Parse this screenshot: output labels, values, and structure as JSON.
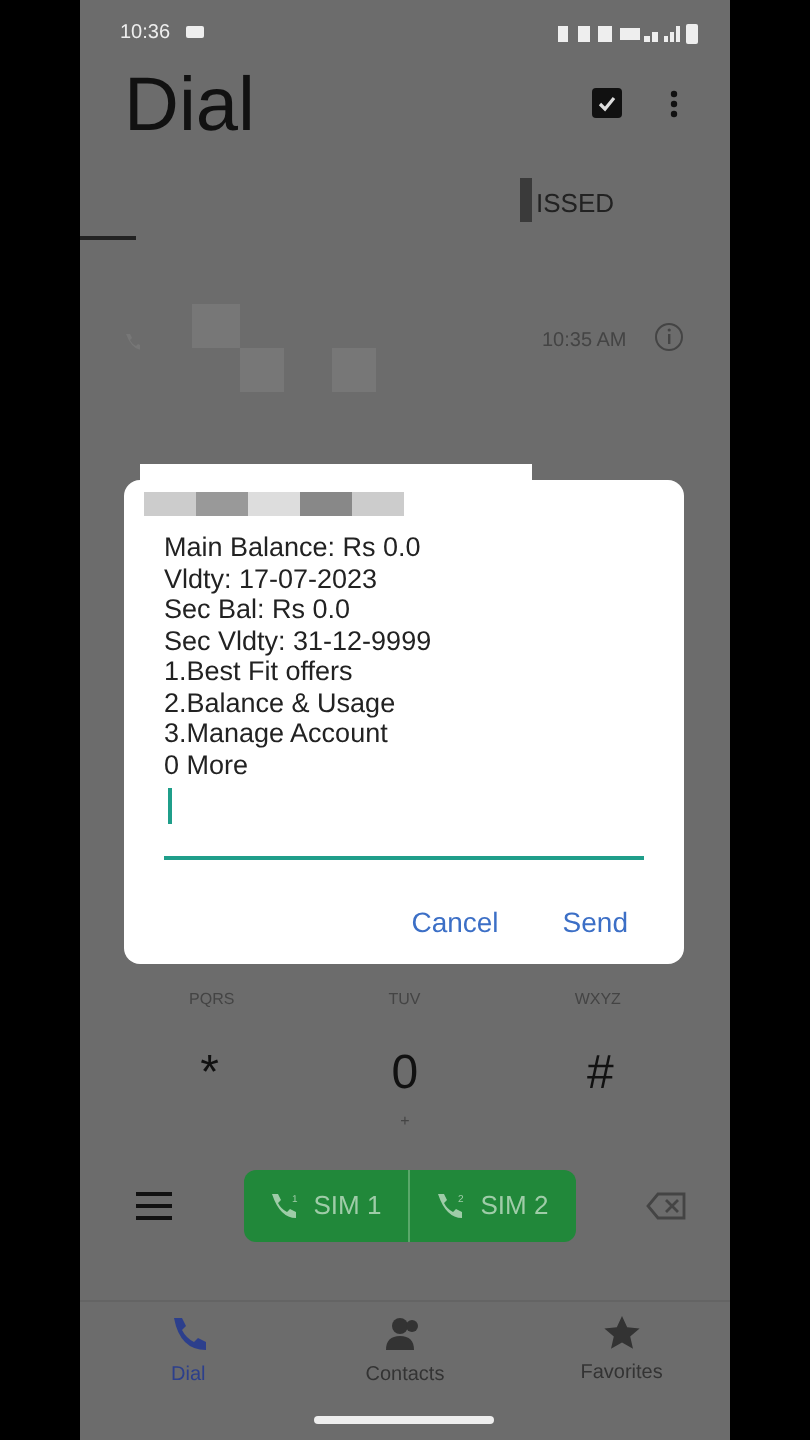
{
  "status_bar": {
    "time": "10:36"
  },
  "header": {
    "title": "Dial"
  },
  "tabs": [
    {
      "label": "ISSED",
      "selected": false
    }
  ],
  "call_log": [
    {
      "time": "10:35 AM"
    }
  ],
  "dialog": {
    "lines": [
      "Main Balance: Rs 0.0",
      "Vldty: 17-07-2023",
      "Sec Bal: Rs 0.0",
      "Sec Vldty: 31-12-9999",
      "1.Best Fit offers",
      "2.Balance & Usage",
      "3.Manage Account",
      "0 More"
    ],
    "buttons": [
      "Cancel",
      "Send"
    ]
  },
  "keypad": {
    "partial_row": [
      "PQRS",
      "TUV",
      "WXYZ"
    ],
    "keys": [
      {
        "digit": "*"
      },
      {
        "digit": "0",
        "sub": "+"
      },
      {
        "digit": "#"
      }
    ]
  },
  "call_buttons": [
    {
      "label": "SIM 1",
      "sim": "1"
    },
    {
      "label": "SIM 2",
      "sim": "2"
    }
  ],
  "bottom_nav": [
    {
      "label": "Dial",
      "selected": true,
      "kind": "phone"
    },
    {
      "label": "Contacts",
      "selected": false,
      "kind": "people"
    },
    {
      "label": "Favorites",
      "selected": false,
      "kind": "star"
    }
  ]
}
